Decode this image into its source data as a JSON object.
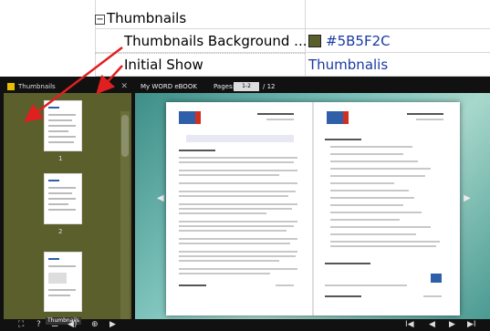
{
  "properties": {
    "group_label": "Thumbnails",
    "rows": [
      {
        "name": "Thumbnails Background ...",
        "value": "#5B5F2C"
      },
      {
        "name": "Initial Show",
        "value": "Thumbnalis"
      }
    ],
    "swatch_color": "#5B5F2C"
  },
  "viewer": {
    "side_title": "Thumbnails",
    "close_glyph": "✕",
    "book_title": "My WORD eBOOK",
    "pages_label": "Pages:",
    "page_input": "1-2",
    "page_total": "/ 12",
    "thumb_numbers": [
      "1",
      "2"
    ],
    "tooltip": "Thumbnails",
    "left_nav": "◀",
    "right_nav": "▶"
  },
  "toolbar": {
    "left_icons": [
      "fullscreen-icon",
      "help-icon",
      "thumbnails-icon",
      "sound-icon",
      "zoom-icon",
      "autoplay-icon"
    ],
    "right_icons": [
      "first-page-icon",
      "prev-page-icon",
      "next-page-icon",
      "last-page-icon"
    ],
    "glyphs": {
      "fullscreen": "⛶",
      "help": "?",
      "thumbnails": "☰",
      "sound": "◀)",
      "zoom": "⊕",
      "autoplay": "▶",
      "first": "I◀",
      "prev": "◀",
      "next": "▶",
      "last": "▶I"
    }
  },
  "colors": {
    "annotation_arrow": "#e02020",
    "panel_bg": "#5B5F2C"
  }
}
